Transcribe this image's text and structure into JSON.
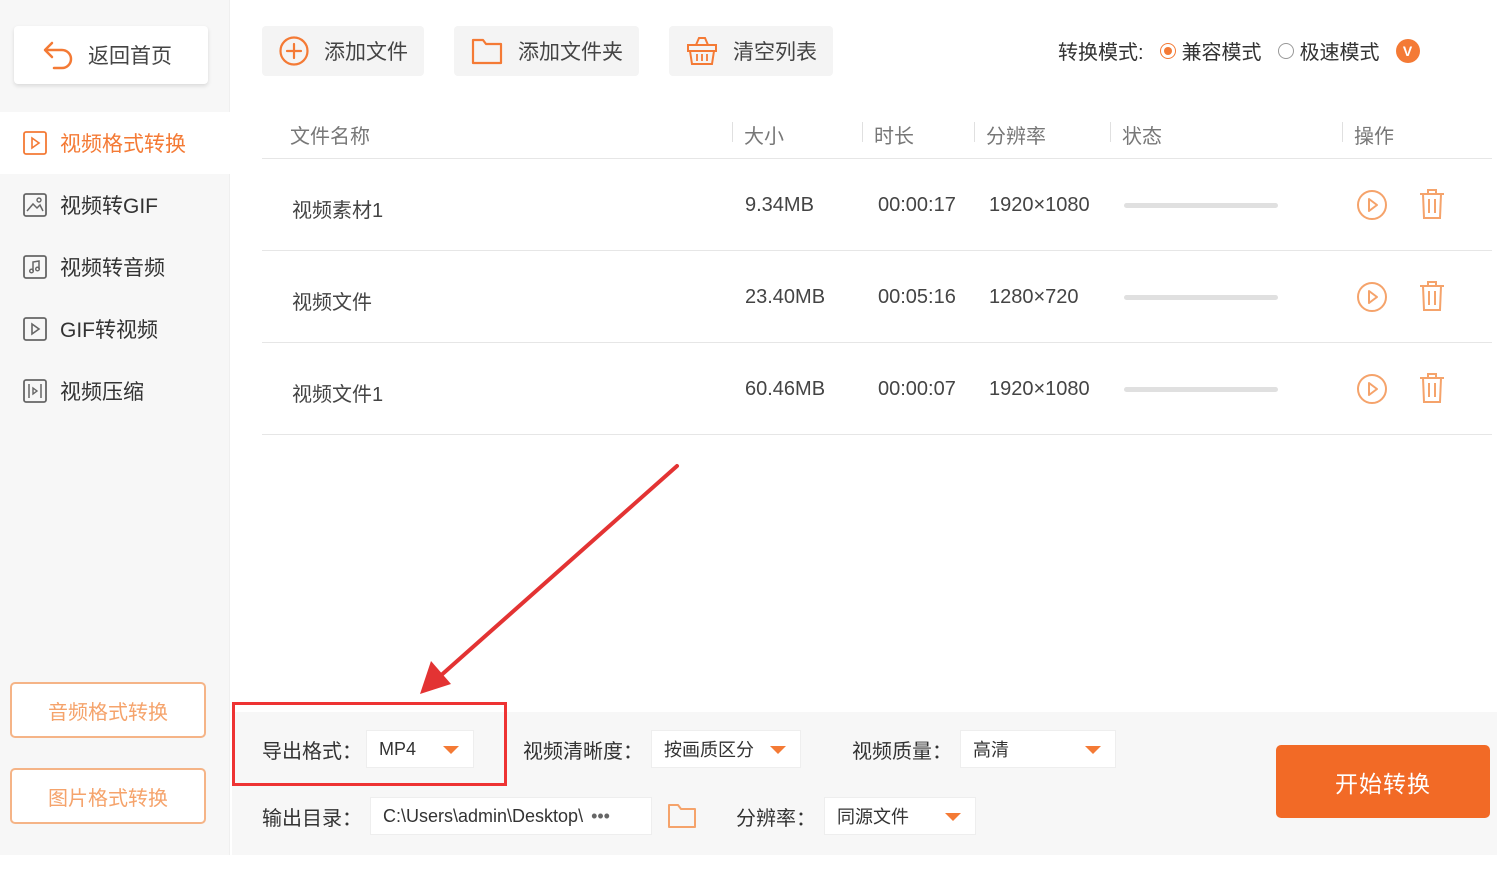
{
  "sidebar": {
    "back_label": "返回首页",
    "items": [
      {
        "label": "视频格式转换",
        "icon": "video-convert-icon",
        "active": true
      },
      {
        "label": "视频转GIF",
        "icon": "gif-image-icon",
        "active": false
      },
      {
        "label": "视频转音频",
        "icon": "audio-note-icon",
        "active": false
      },
      {
        "label": "GIF转视频",
        "icon": "play-icon",
        "active": false
      },
      {
        "label": "视频压缩",
        "icon": "compress-icon",
        "active": false
      }
    ],
    "audio_convert_label": "音频格式转换",
    "image_convert_label": "图片格式转换"
  },
  "toolbar": {
    "add_file_label": "添加文件",
    "add_folder_label": "添加文件夹",
    "clear_list_label": "清空列表",
    "mode_label": "转换模式:",
    "mode_options": [
      "兼容模式",
      "极速模式"
    ],
    "mode_selected": "兼容模式",
    "vip_badge": "V"
  },
  "table": {
    "headers": [
      "文件名称",
      "大小",
      "时长",
      "分辨率",
      "状态",
      "操作"
    ],
    "rows": [
      {
        "name": "视频素材1",
        "size": "9.34MB",
        "duration": "00:00:17",
        "resolution": "1920×1080",
        "progress": 0
      },
      {
        "name": "视频文件",
        "size": "23.40MB",
        "duration": "00:05:16",
        "resolution": "1280×720",
        "progress": 0
      },
      {
        "name": "视频文件1",
        "size": "60.46MB",
        "duration": "00:00:07",
        "resolution": "1920×1080",
        "progress": 0
      }
    ]
  },
  "bottom": {
    "export_format_label": "导出格式：",
    "export_format_value": "MP4",
    "clarity_label": "视频清晰度：",
    "clarity_value": "按画质区分",
    "quality_label": "视频质量：",
    "quality_value": "高清",
    "output_dir_label": "输出目录：",
    "output_dir_value": "C:\\Users\\admin\\Desktop\\",
    "output_dir_more": "•••",
    "resolution_label": "分辨率：",
    "resolution_value": "同源文件",
    "start_label": "开始转换"
  },
  "colors": {
    "accent": "#f47a35",
    "start_button": "#f26a26",
    "annotation": "#e33333"
  }
}
